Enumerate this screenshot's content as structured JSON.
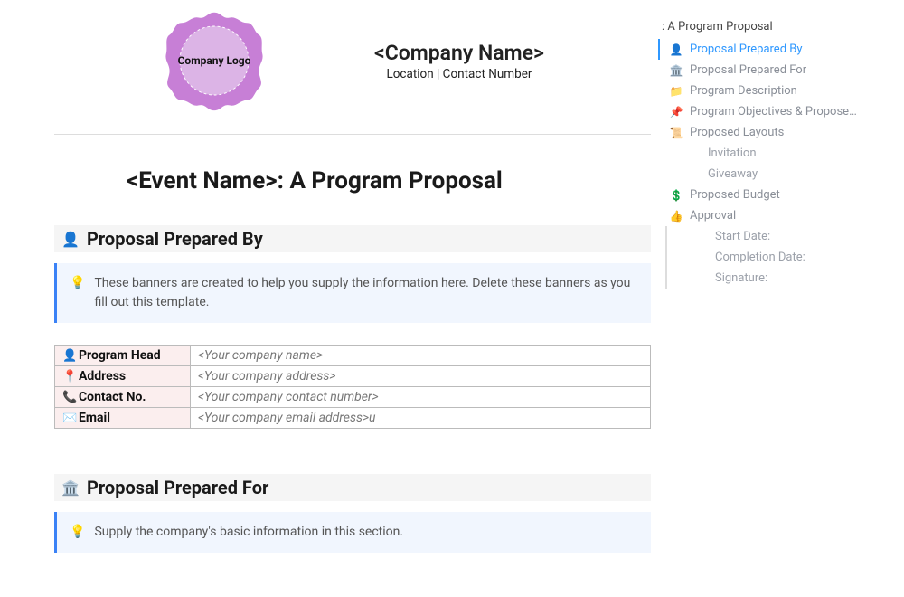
{
  "logo_text": "Company Logo",
  "company_name": "<Company Name>",
  "company_sub": "Location | Contact Number",
  "doc_title": "<Event Name>: A Program Proposal",
  "section1": {
    "icon": "👤",
    "title": "Proposal Prepared By",
    "callout": "These banners are created to help you supply the information here. Delete these banners as you fill out this template.",
    "rows": [
      {
        "icon": "👤",
        "label": "Program Head",
        "value": "<Your company name>"
      },
      {
        "icon": "📍",
        "label": "Address",
        "value": "<Your company address>"
      },
      {
        "icon": "📞",
        "label": "Contact No.",
        "value": "<Your company contact number>"
      },
      {
        "icon": "✉️",
        "label": "Email",
        "value": "<Your company email address>u"
      }
    ]
  },
  "section2": {
    "icon": "🏛️",
    "title": "Proposal Prepared For",
    "callout": "Supply the company's basic information in this section."
  },
  "outline": {
    "title": ": A Program Proposal",
    "items": [
      {
        "icon": "👤",
        "label": "Proposal Prepared By",
        "active": true
      },
      {
        "icon": "🏛️",
        "label": "Proposal Prepared For"
      },
      {
        "icon": "📁",
        "label": "Program Description"
      },
      {
        "icon": "📌",
        "label": "Program Objectives & Proposed S…"
      },
      {
        "icon": "📜",
        "label": "Proposed Layouts"
      },
      {
        "icon": "",
        "label": "Invitation",
        "sub": true
      },
      {
        "icon": "",
        "label": "Giveaway",
        "sub": true
      },
      {
        "icon": "💲",
        "label": "Proposed Budget"
      },
      {
        "icon": "👍",
        "label": "Approval"
      },
      {
        "icon": "",
        "label": "Start Date:",
        "sub2": true
      },
      {
        "icon": "",
        "label": "Completion Date:",
        "sub2": true
      },
      {
        "icon": "",
        "label": "Signature:",
        "sub2": true
      }
    ]
  }
}
